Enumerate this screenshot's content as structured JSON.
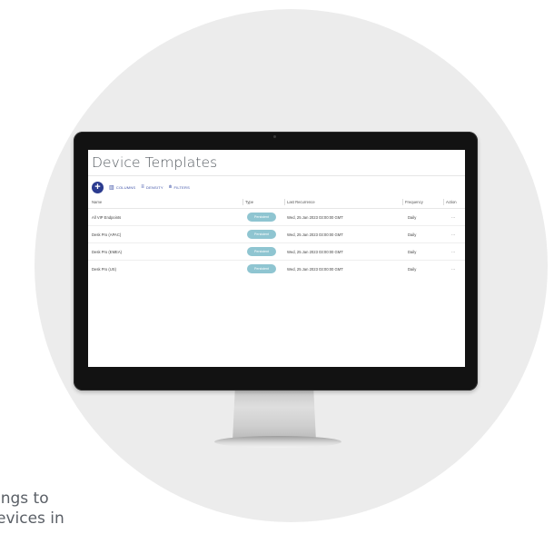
{
  "side_text": [
    "ings to",
    "evices in"
  ],
  "screen": {
    "title": "Device Templates",
    "toolbar": {
      "add_label": "+",
      "columns": "COLUMNS",
      "density": "DENSITY",
      "filters": "FILTERS"
    },
    "columns": [
      "Name",
      "Type",
      "Last Recurrence",
      "Frequency",
      "Action"
    ],
    "rows": [
      {
        "name": "All VIP Endpoints",
        "type": "Persistent",
        "last": "Wed, 25 Jan 2023 03:00:00 GMT",
        "frequency": "Daily",
        "action": "···"
      },
      {
        "name": "Desk Pro (APAC)",
        "type": "Persistent",
        "last": "Wed, 25 Jan 2023 03:00:00 GMT",
        "frequency": "Daily",
        "action": "···"
      },
      {
        "name": "Desk Pro (EMEA)",
        "type": "Persistent",
        "last": "Wed, 25 Jan 2023 03:00:00 GMT",
        "frequency": "Daily",
        "action": "···"
      },
      {
        "name": "Desk Pro (US)",
        "type": "Persistent",
        "last": "Wed, 25 Jan 2023 03:00:00 GMT",
        "frequency": "Daily",
        "action": "···"
      }
    ]
  },
  "colors": {
    "accent": "#2b3b8f",
    "badge": "#8fc5d1",
    "bezel": "#121212",
    "background_circle": "#ececec"
  },
  "icons": [
    "plus-icon",
    "columns-icon",
    "density-icon",
    "filter-icon",
    "more-icon"
  ]
}
